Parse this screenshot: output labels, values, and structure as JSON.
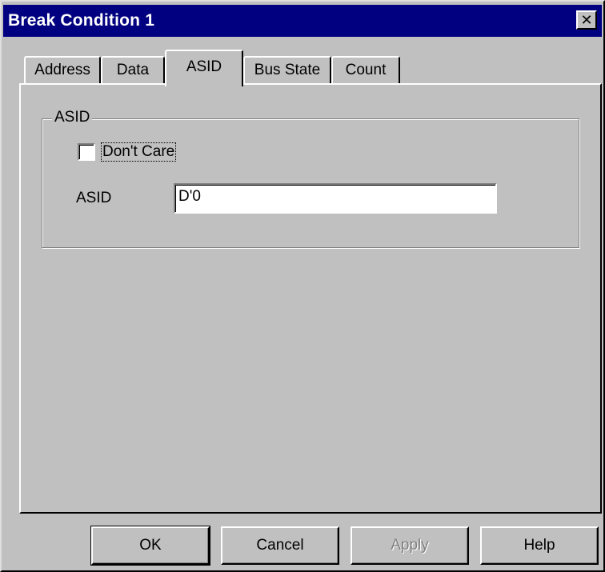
{
  "window": {
    "title": "Break Condition 1",
    "close_glyph": "✕"
  },
  "tabs": [
    {
      "label": "Address",
      "active": false
    },
    {
      "label": "Data",
      "active": false
    },
    {
      "label": "ASID",
      "active": true
    },
    {
      "label": "Bus State",
      "active": false
    },
    {
      "label": "Count",
      "active": false
    }
  ],
  "asid_group": {
    "title": "ASID",
    "dont_care": {
      "label": "Don't Care",
      "checked": false
    },
    "field_label": "ASID",
    "field_value": "D'0"
  },
  "buttons": {
    "ok": "OK",
    "cancel": "Cancel",
    "apply": "Apply",
    "help": "Help"
  },
  "colors": {
    "title_bar": "#000080",
    "face": "#c0c0c0"
  }
}
